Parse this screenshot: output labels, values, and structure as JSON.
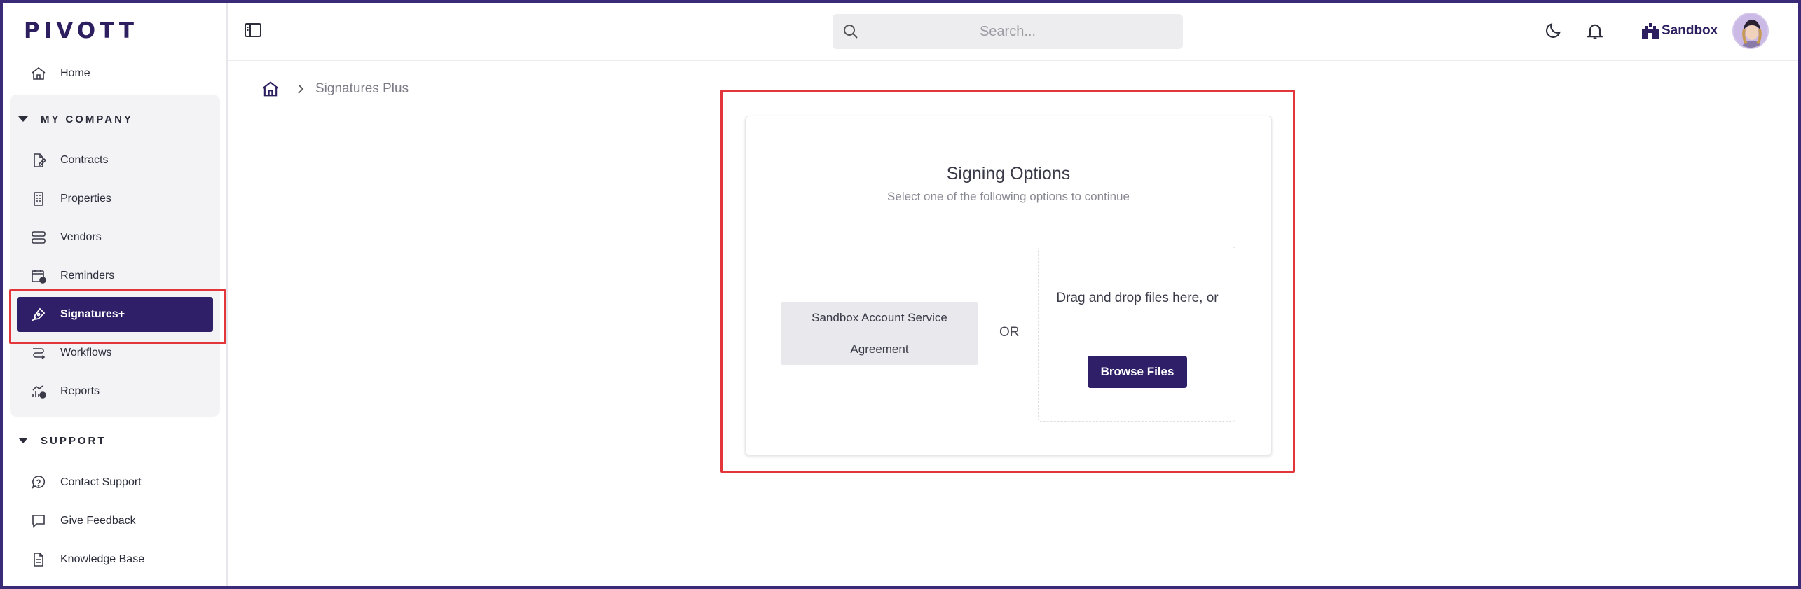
{
  "brand": {
    "logo_text": "PIVOTT",
    "color": "#2d1e5f"
  },
  "sidebar": {
    "home": {
      "label": "Home",
      "icon": "home-icon"
    },
    "my_company": {
      "heading": "MY COMPANY",
      "items": [
        {
          "label": "Contracts",
          "icon": "contract-icon"
        },
        {
          "label": "Properties",
          "icon": "building-icon"
        },
        {
          "label": "Vendors",
          "icon": "vendor-icon"
        },
        {
          "label": "Reminders",
          "icon": "calendar-icon"
        },
        {
          "label": "Signatures+",
          "icon": "signature-pen-icon",
          "active": true
        },
        {
          "label": "Workflows",
          "icon": "workflow-icon"
        },
        {
          "label": "Reports",
          "icon": "reports-icon"
        }
      ]
    },
    "support": {
      "heading": "SUPPORT",
      "items": [
        {
          "label": "Contact Support",
          "icon": "help-bubble-icon"
        },
        {
          "label": "Give Feedback",
          "icon": "feedback-icon"
        },
        {
          "label": "Knowledge Base",
          "icon": "document-icon"
        }
      ]
    }
  },
  "topbar": {
    "search_placeholder": "Search...",
    "workspace_label": "Sandbox"
  },
  "breadcrumb": {
    "current": "Signatures Plus"
  },
  "signing": {
    "title": "Signing Options",
    "subtitle": "Select one of the following options to continue",
    "option_label": "Sandbox Account Service Agreement",
    "or_label": "OR",
    "drop_text": "Drag and drop files here, or",
    "browse_label": "Browse Files"
  },
  "colors": {
    "accent": "#2e1f68",
    "highlight": "#e2363b",
    "frame": "#3a2a78"
  }
}
